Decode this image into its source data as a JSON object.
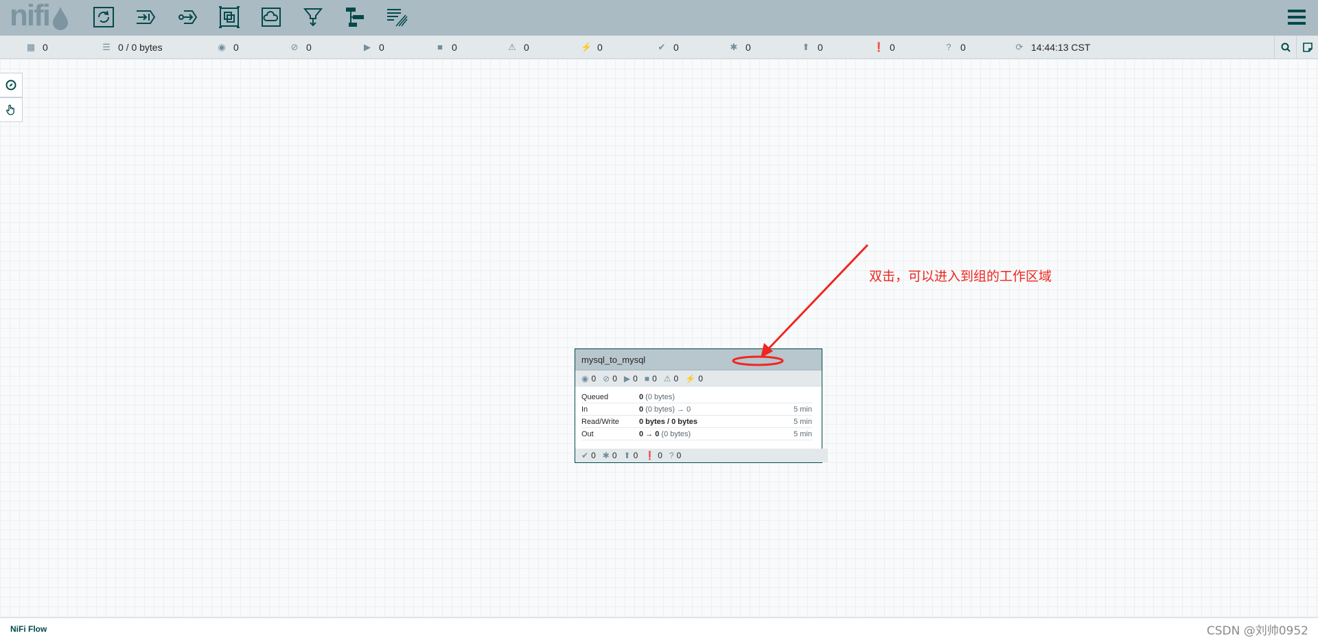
{
  "header": {
    "logo_text": "nifi",
    "tools": [
      {
        "name": "processor-tool",
        "icon": "processor-icon"
      },
      {
        "name": "input-port-tool",
        "icon": "input-port-icon"
      },
      {
        "name": "output-port-tool",
        "icon": "output-port-icon"
      },
      {
        "name": "process-group-tool",
        "icon": "process-group-icon"
      },
      {
        "name": "remote-process-group-tool",
        "icon": "remote-process-group-icon"
      },
      {
        "name": "funnel-tool",
        "icon": "funnel-icon"
      },
      {
        "name": "template-tool",
        "icon": "template-icon"
      },
      {
        "name": "label-tool",
        "icon": "label-icon"
      }
    ]
  },
  "status": {
    "active_threads": "0",
    "queued": "0 / 0 bytes",
    "transmitting": "0",
    "not_transmitting": "0",
    "running": "0",
    "stopped": "0",
    "invalid": "0",
    "disabled": "0",
    "up_to_date": "0",
    "locally_modified": "0",
    "stale": "0",
    "locally_modified_stale": "0",
    "sync_failure": "0",
    "last_refreshed": "14:44:13 CST"
  },
  "process_group": {
    "name": "mysql_to_mysql",
    "stats": {
      "transmitting": "0",
      "not_transmitting": "0",
      "running": "0",
      "stopped": "0",
      "invalid": "0",
      "disabled": "0"
    },
    "rows": [
      {
        "label": "Queued",
        "value_bold": "0",
        "value_rest": "(0 bytes)",
        "time": ""
      },
      {
        "label": "In",
        "value_bold": "0",
        "value_rest": "(0 bytes) → 0",
        "time": "5 min"
      },
      {
        "label": "Read/Write",
        "value_bold": "0 bytes / 0 bytes",
        "value_rest": "",
        "time": "5 min"
      },
      {
        "label": "Out",
        "value_bold": "0 → 0",
        "value_rest": "(0 bytes)",
        "time": "5 min"
      }
    ],
    "footer": {
      "up_to_date": "0",
      "locally_modified": "0",
      "stale": "0",
      "locally_modified_stale": "0",
      "sync_failure": "0"
    }
  },
  "annotation": {
    "text": "双击，可以进入到组的工作区域",
    "color": "#f0261f"
  },
  "breadcrumb": "NiFi Flow",
  "watermark": "CSDN @刘帅0952"
}
